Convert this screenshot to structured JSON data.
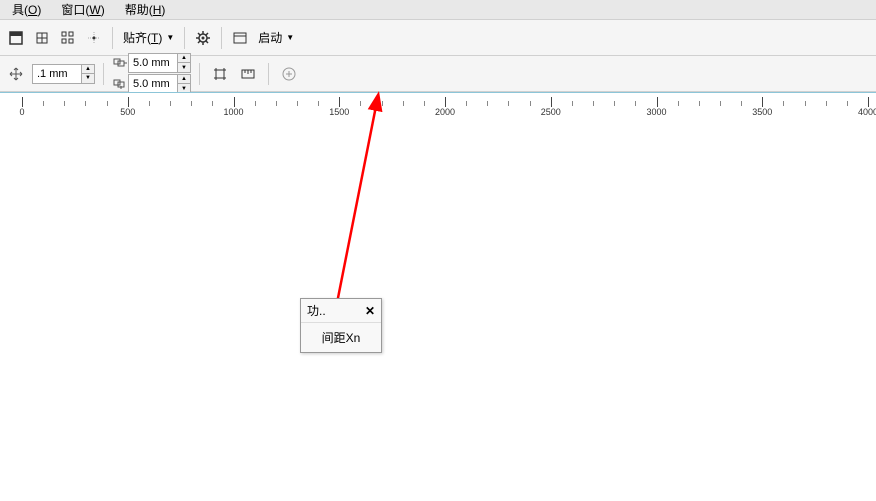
{
  "menu": {
    "tools": {
      "text": "具",
      "accel": "O"
    },
    "window": {
      "text": "窗口",
      "accel": "W"
    },
    "help": {
      "text": "帮助",
      "accel": "H"
    }
  },
  "toolbar1": {
    "snap_label": "贴齐",
    "snap_accel": "T",
    "launch_label": "启动"
  },
  "toolbar2": {
    "nudge_value": ".1 mm",
    "dup_x": "5.0 mm",
    "dup_y": "5.0 mm"
  },
  "ruler": {
    "ticks": [
      0,
      500,
      1000,
      1500,
      2000,
      2500,
      3000,
      3500,
      4000
    ]
  },
  "panel": {
    "title": "功..",
    "body": "间距Xn"
  }
}
